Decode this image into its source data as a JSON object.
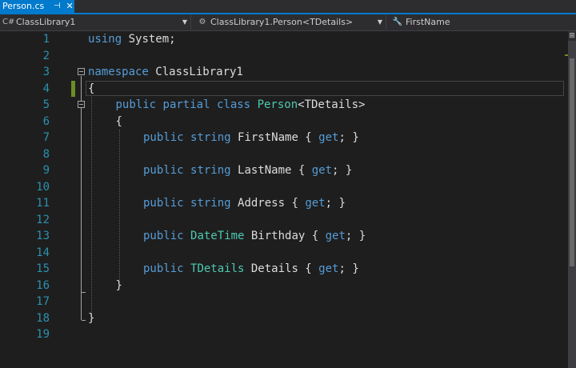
{
  "tab": {
    "title": "Person.cs",
    "pin_icon": "pin-icon",
    "close_icon": "close-icon"
  },
  "navbar": {
    "project": "ClassLibrary1",
    "type": "ClassLibrary1.Person<TDetails>",
    "member": "FirstName"
  },
  "editor": {
    "line_numbers": [
      "1",
      "2",
      "3",
      "4",
      "5",
      "6",
      "7",
      "8",
      "9",
      "10",
      "11",
      "12",
      "13",
      "14",
      "15",
      "16",
      "17",
      "18",
      "19"
    ],
    "current_line": 4
  },
  "colors": {
    "keyword": "#569cd6",
    "type": "#4ec9b0",
    "plain": "#dcdcdc",
    "line_number": "#2b91af",
    "accent": "#007acc",
    "change_marker": "#6b8e23"
  }
}
